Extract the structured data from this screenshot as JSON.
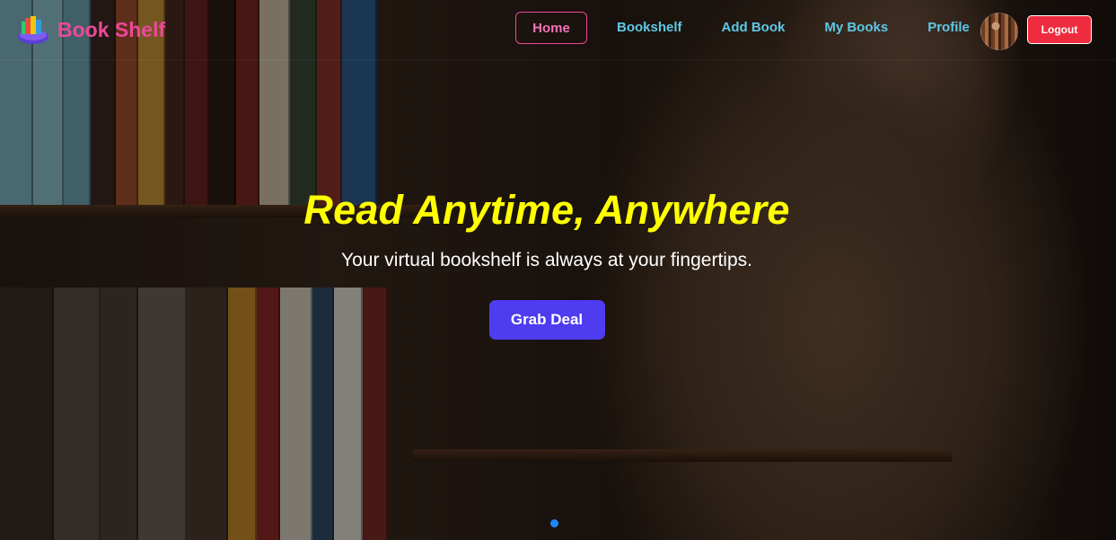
{
  "brand": {
    "name": "Book Shelf",
    "logo_icon": "book-stack-icon",
    "color": "#ec4899"
  },
  "nav": {
    "items": [
      {
        "label": "Home",
        "active": true
      },
      {
        "label": "Bookshelf",
        "active": false
      },
      {
        "label": "Add Book",
        "active": false
      },
      {
        "label": "My Books",
        "active": false
      },
      {
        "label": "Profile",
        "active": false
      }
    ],
    "link_color": "#5ec8e6",
    "active_color": "#f472b6",
    "logout_label": "Logout",
    "logout_color": "#ef2b3f"
  },
  "hero": {
    "title": "Read Anytime, Anywhere",
    "subtitle": "Your virtual bookshelf is always at your fingertips.",
    "cta_label": "Grab Deal",
    "title_color": "#ffff00",
    "cta_color": "#4f3cf0"
  },
  "carousel": {
    "active_dot_color": "#1e88ff"
  }
}
